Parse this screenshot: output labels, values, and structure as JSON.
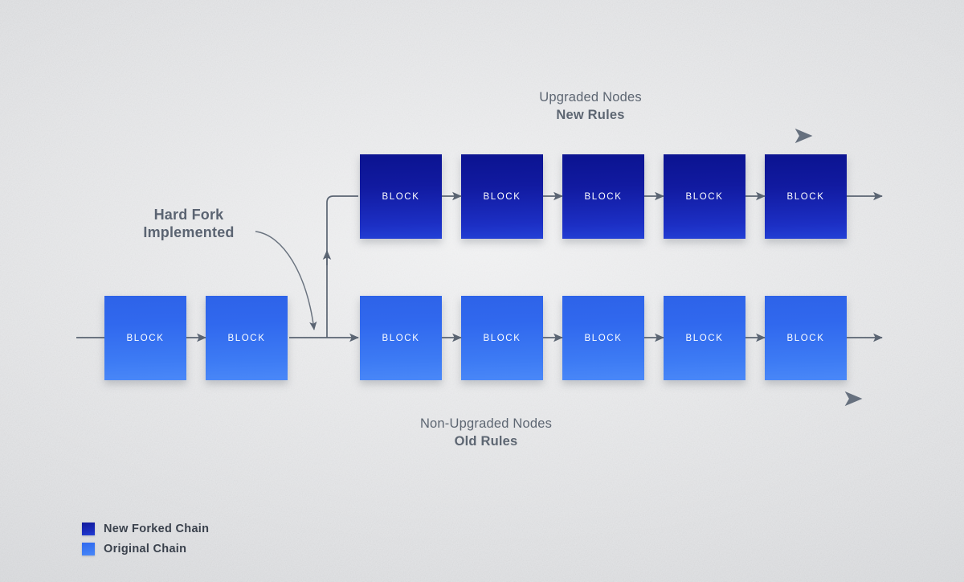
{
  "background": {
    "color": "#e4e5e7",
    "texture": "fine-noise"
  },
  "palette": {
    "new_chain": "#111aa0",
    "original_chain": "#3068ee",
    "connector": "#5a6472",
    "label_text": "#5d6672",
    "legend_text": "#3a414c"
  },
  "labels": {
    "hard_fork": {
      "line1": "Hard Fork",
      "line2": "Implemented"
    },
    "upgraded": {
      "line1": "Upgraded Nodes",
      "line2": "New Rules"
    },
    "non_upgraded": {
      "line1": "Non-Upgraded Nodes",
      "line2": "Old Rules"
    }
  },
  "chains": {
    "original_pre_fork": {
      "name": "Original Chain",
      "blocks": [
        {
          "label": "BLOCK"
        },
        {
          "label": "BLOCK"
        }
      ]
    },
    "new_forked": {
      "name": "New Forked Chain",
      "blocks": [
        {
          "label": "BLOCK"
        },
        {
          "label": "BLOCK"
        },
        {
          "label": "BLOCK"
        },
        {
          "label": "BLOCK"
        },
        {
          "label": "BLOCK"
        }
      ]
    },
    "original_post_fork": {
      "name": "Original Chain",
      "blocks": [
        {
          "label": "BLOCK"
        },
        {
          "label": "BLOCK"
        },
        {
          "label": "BLOCK"
        },
        {
          "label": "BLOCK"
        },
        {
          "label": "BLOCK"
        }
      ]
    }
  },
  "legend": {
    "items": [
      {
        "label": "New Forked Chain",
        "color": "#111aa0",
        "swatch": "new"
      },
      {
        "label": "Original Chain",
        "color": "#3068ee",
        "swatch": "orig"
      }
    ]
  }
}
